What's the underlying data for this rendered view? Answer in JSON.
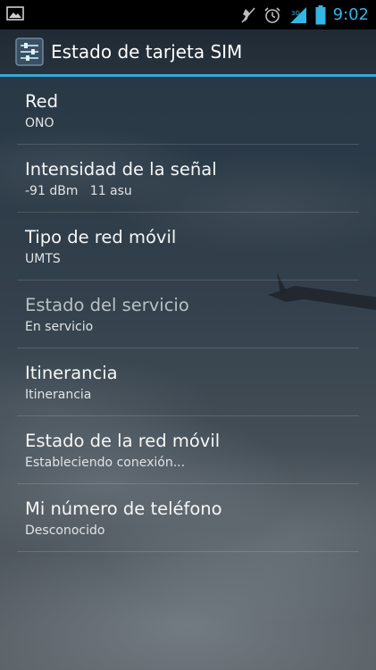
{
  "status_bar": {
    "time": "9:02",
    "colors": {
      "clock": "#33b5e5",
      "battery": "#33b5e5",
      "signal": "#33b5e5"
    },
    "icons": [
      "image-notification-icon",
      "mute-icon",
      "alarm-icon",
      "signal-icon",
      "battery-icon"
    ]
  },
  "action_bar": {
    "title": "Estado de tarjeta SIM",
    "icon": "settings-sliders-icon",
    "accent": "#3aa9d6"
  },
  "items": [
    {
      "title": "Red",
      "summary": "ONO"
    },
    {
      "title": "Intensidad de la señal",
      "summary": "-91 dBm   11 asu"
    },
    {
      "title": "Tipo de red móvil",
      "summary": "UMTS"
    },
    {
      "title": "Estado del servicio",
      "summary": "En servicio"
    },
    {
      "title": "Itinerancia",
      "summary": "Itinerancia"
    },
    {
      "title": "Estado de la red móvil",
      "summary": "Estableciendo conexión..."
    },
    {
      "title": "Mi número de teléfono",
      "summary": "Desconocido"
    }
  ]
}
